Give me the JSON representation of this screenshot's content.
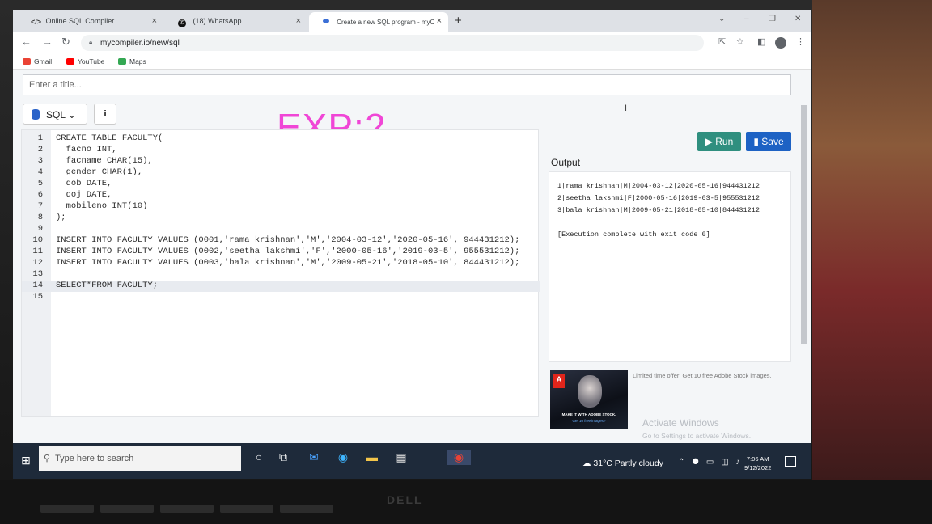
{
  "browser": {
    "tabs": [
      {
        "title": "Online SQL Compiler",
        "icon": "code-icon",
        "active": false
      },
      {
        "title": "(18) WhatsApp",
        "icon": "whatsapp-icon",
        "active": false
      },
      {
        "title": "Create a new SQL program - myC",
        "icon": "mycompiler-icon",
        "active": true
      }
    ],
    "url": "mycompiler.io/new/sql",
    "bookmarks": [
      "Gmail",
      "YouTube",
      "Maps"
    ]
  },
  "page": {
    "title_placeholder": "Enter a title...",
    "language": "SQL",
    "overlay_label": "EXP:2",
    "run_label": "Run",
    "save_label": "Save",
    "output_label": "Output"
  },
  "editor": {
    "lines": [
      "CREATE TABLE FACULTY(",
      "  facno INT,",
      "  facname CHAR(15),",
      "  gender CHAR(1),",
      "  dob DATE,",
      "  doj DATE,",
      "  mobileno INT(10)",
      ");",
      "",
      "INSERT INTO FACULTY VALUES (0001,'rama krishnan','M','2004-03-12','2020-05-16', 944431212);",
      "INSERT INTO FACULTY VALUES (0002,'seetha lakshmi','F','2000-05-16','2019-03-5', 955531212);",
      "INSERT INTO FACULTY VALUES (0003,'bala krishnan','M','2009-05-21','2018-05-10', 844431212);",
      "",
      "SELECT*FROM FACULTY;",
      ""
    ],
    "active_line": 14
  },
  "output": {
    "lines": [
      "1|rama krishnan|M|2004-03-12|2020-05-16|944431212",
      "2|seetha lakshmi|F|2000-05-16|2019-03-5|955531212",
      "3|bala krishnan|M|2009-05-21|2018-05-10|844431212",
      "",
      "[Execution complete with exit code 0]"
    ]
  },
  "ad": {
    "tagline": "MAKE IT WITH ADOBE STOCK.",
    "cta": "Get 10 free images ›",
    "text": "Limited time offer: Get 10 free Adobe Stock images."
  },
  "windows_notice": {
    "title": "Activate Windows",
    "subtitle": "Go to Settings to activate Windows."
  },
  "taskbar": {
    "search_placeholder": "Type here to search",
    "weather": "31°C  Partly cloudy",
    "time": "7:06 AM",
    "date": "9/12/2022"
  },
  "brand": "DELL"
}
